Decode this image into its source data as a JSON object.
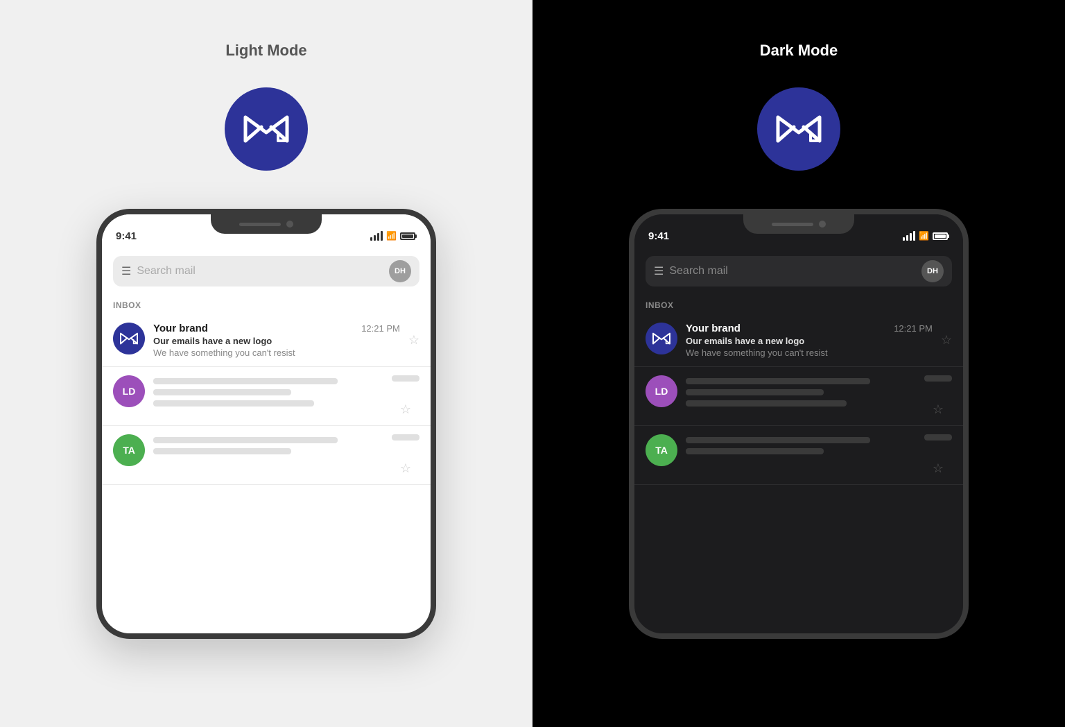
{
  "lightMode": {
    "label": "Light Mode",
    "background": "#f0f0f0",
    "textColor": "#555"
  },
  "darkMode": {
    "label": "Dark Mode",
    "background": "#000000",
    "textColor": "#ffffff"
  },
  "appIcon": {
    "label": "M logo icon"
  },
  "phone": {
    "statusTime": "9:41",
    "searchPlaceholder": "Search mail",
    "avatarText": "DH",
    "inboxLabel": "INBOX",
    "email1": {
      "sender": "Your brand",
      "subject": "Our emails have a new logo",
      "preview": "We have something you can't resist",
      "time": "12:21 PM"
    },
    "email2": {
      "avatarText": "LD"
    },
    "email3": {
      "avatarText": "TA"
    }
  }
}
